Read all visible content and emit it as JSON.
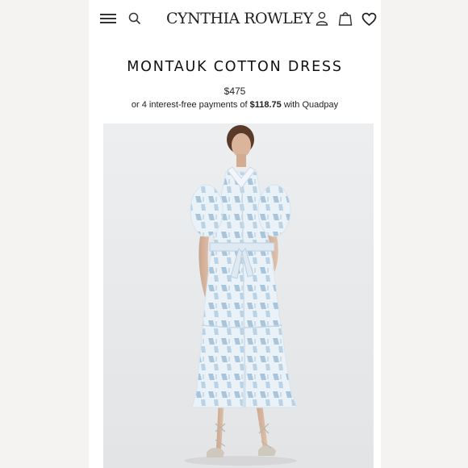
{
  "header": {
    "brand": "CYNTHIA ROWLEY",
    "menu_icon": "hamburger-menu-icon",
    "search_icon": "search-icon",
    "account_icon": "user-icon",
    "bag_icon": "shopping-bag-icon",
    "wishlist_icon": "heart-icon"
  },
  "product": {
    "title": "MONTAUK COTTON DRESS",
    "price": "$475",
    "installments": {
      "prefix": "or 4 interest-free payments of",
      "amount": "$118.75",
      "suffix": "with Quadpay"
    },
    "image_alt": "Model wearing a light blue geometric print cotton midi shirt dress with puff sleeves and tie waist"
  },
  "colors": {
    "dress_base": "#eaf1f7",
    "dress_print": "#a7c6de",
    "background": "#ffffff"
  }
}
